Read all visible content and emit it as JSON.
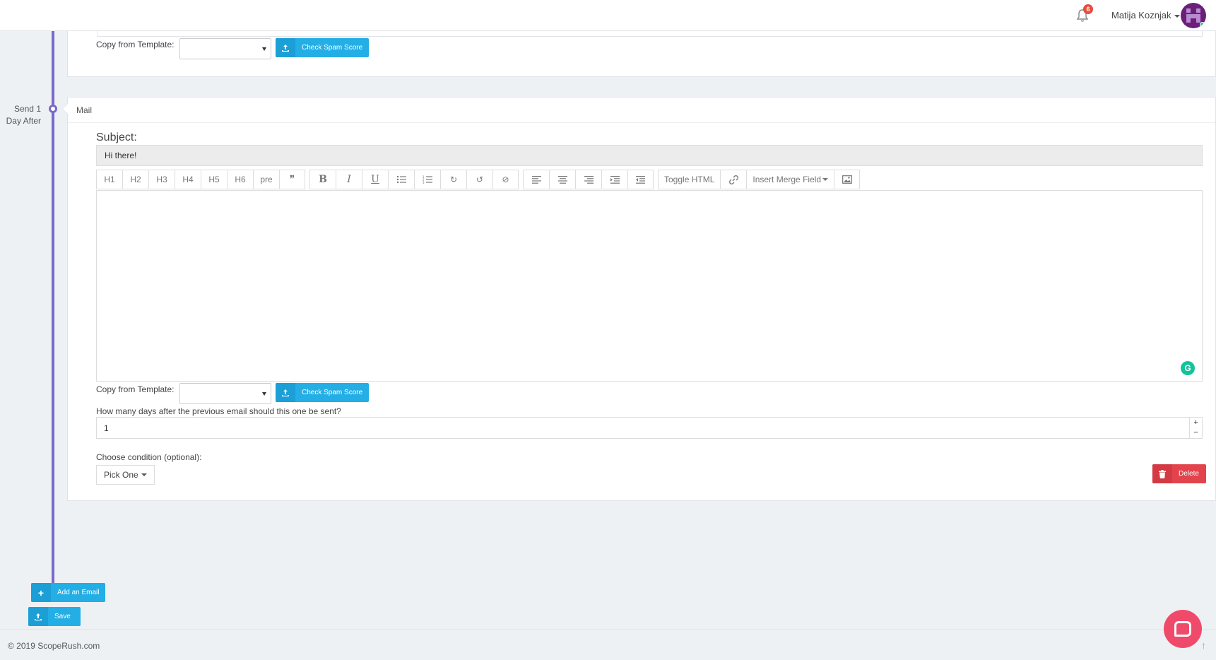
{
  "header": {
    "notification_count": "6",
    "user_name": "Matija Koznjak"
  },
  "timeline": {
    "step_label_line1": "Send 1",
    "step_label_line2": "Day After"
  },
  "card1": {
    "copy_from_template_label": "Copy from Template:",
    "template_selected": "",
    "check_spam_label": "Check Spam Score"
  },
  "card2": {
    "header": "Mail",
    "subject_label": "Subject:",
    "subject_value": "Hi there!",
    "toolbar": {
      "headings": [
        "H1",
        "H2",
        "H3",
        "H4",
        "H5",
        "H6",
        "pre"
      ],
      "toggle_html": "Toggle HTML",
      "insert_merge_field": "Insert Merge Field"
    },
    "copy_from_template_label": "Copy from Template:",
    "template_selected": "",
    "check_spam_label": "Check Spam Score",
    "days_question": "How many days after the previous email should this one be sent?",
    "days_value": "1",
    "condition_label": "Choose condition (optional):",
    "condition_selected": "Pick One",
    "delete_label": "Delete"
  },
  "actions": {
    "add_email_label": "Add an Email",
    "save_label": "Save"
  },
  "footer": {
    "copyright": "© 2019  ScopeRush.com"
  },
  "colors": {
    "accent_blue": "#23aee5",
    "timeline_purple": "#7a6acb",
    "danger_red": "#e3434c",
    "chat_pink": "#f04a6a"
  }
}
